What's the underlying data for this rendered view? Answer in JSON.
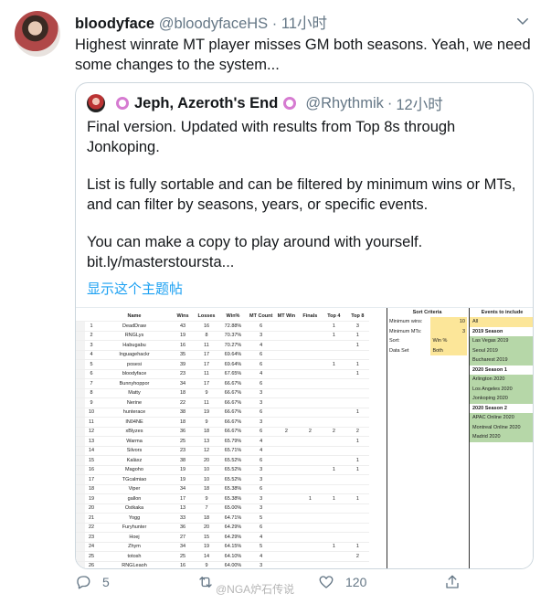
{
  "tweet": {
    "author_name": "bloodyface",
    "author_handle": "@bloodyfaceHS",
    "separator": "·",
    "time": "11小时",
    "text": "Highest winrate MT player misses GM both seasons. Yeah, we need some changes to the system..."
  },
  "quote": {
    "author_name": "Jeph, Azeroth's End",
    "author_handle": "@Rhythmik",
    "separator": "·",
    "time": "12小时",
    "paragraphs": [
      "Final version. Updated with results from Top 8s through Jonkoping.",
      "List is fully sortable and can be filtered by minimum wins or MTs, and can filter by seasons, years, or specific events.",
      "You can make a copy to play around with yourself. bit.ly/masterstoursta..."
    ],
    "translate_label": "显示这个主题帖"
  },
  "sheet": {
    "headers": [
      "Name",
      "Wins",
      "Losses",
      "Win%",
      "MT Count",
      "MT Win",
      "Finals",
      "Top 4",
      "Top 8"
    ],
    "rows": [
      [
        "1",
        "DeadDraw",
        "43",
        "16",
        "72.88%",
        "6",
        "",
        "",
        "1",
        "3"
      ],
      [
        "2",
        "RNGLys",
        "19",
        "8",
        "70.37%",
        "3",
        "",
        "",
        "1",
        "1"
      ],
      [
        "3",
        "Habugabu",
        "16",
        "11",
        "70.27%",
        "4",
        "",
        "",
        "",
        "1"
      ],
      [
        "4",
        "Inguagehackr",
        "35",
        "17",
        "69.64%",
        "6",
        "",
        "",
        "",
        ""
      ],
      [
        "5",
        "posesi",
        "39",
        "17",
        "69.64%",
        "6",
        "",
        "",
        "1",
        "1"
      ],
      [
        "6",
        "bloodyface",
        "23",
        "11",
        "67.65%",
        "4",
        "",
        "",
        "",
        "1"
      ],
      [
        "7",
        "Bunnyhoppor",
        "34",
        "17",
        "66.67%",
        "6",
        "",
        "",
        "",
        ""
      ],
      [
        "8",
        "Matty",
        "18",
        "9",
        "66.67%",
        "3",
        "",
        "",
        "",
        ""
      ],
      [
        "9",
        "Nerine",
        "22",
        "11",
        "66.67%",
        "3",
        "",
        "",
        "",
        ""
      ],
      [
        "10",
        "hunterace",
        "38",
        "19",
        "66.67%",
        "6",
        "",
        "",
        "",
        "1"
      ],
      [
        "11",
        "IN04NE",
        "18",
        "9",
        "66.67%",
        "3",
        "",
        "",
        "",
        ""
      ],
      [
        "12",
        "xBlyzes",
        "36",
        "18",
        "66.67%",
        "6",
        "2",
        "2",
        "2",
        "2"
      ],
      [
        "13",
        "Warma",
        "25",
        "13",
        "65.79%",
        "4",
        "",
        "",
        "",
        "1"
      ],
      [
        "14",
        "Silvors",
        "23",
        "12",
        "65.71%",
        "4",
        "",
        "",
        "",
        ""
      ],
      [
        "15",
        "Kalàxz",
        "38",
        "20",
        "65.52%",
        "6",
        "",
        "",
        "",
        "1"
      ],
      [
        "16",
        "Magoho",
        "19",
        "10",
        "65.52%",
        "3",
        "",
        "",
        "1",
        "1"
      ],
      [
        "17",
        "TGcalmiao",
        "19",
        "10",
        "65.52%",
        "3",
        "",
        "",
        "",
        ""
      ],
      [
        "18",
        "Viper",
        "34",
        "18",
        "65.38%",
        "6",
        "",
        "",
        "",
        ""
      ],
      [
        "19",
        "gallon",
        "17",
        "9",
        "65.38%",
        "3",
        "",
        "1",
        "1",
        "1"
      ],
      [
        "20",
        "Ostkaka",
        "13",
        "7",
        "65.00%",
        "3",
        "",
        "",
        "",
        ""
      ],
      [
        "21",
        "Yogg",
        "33",
        "18",
        "64.71%",
        "5",
        "",
        "",
        "",
        ""
      ],
      [
        "22",
        "Furyhunter",
        "36",
        "20",
        "64.29%",
        "6",
        "",
        "",
        "",
        ""
      ],
      [
        "23",
        "Hoej",
        "27",
        "15",
        "64.29%",
        "4",
        "",
        "",
        "",
        ""
      ],
      [
        "24",
        "Zhym",
        "34",
        "19",
        "64.15%",
        "5",
        "",
        "",
        "1",
        "1"
      ],
      [
        "25",
        "totosh",
        "25",
        "14",
        "64.10%",
        "4",
        "",
        "",
        "",
        "2"
      ],
      [
        "26",
        "RNGLeaoh",
        "16",
        "9",
        "64.00%",
        "3",
        "",
        "",
        "",
        ""
      ],
      [
        "27",
        "Felkeine",
        "29",
        "22",
        "63.93%",
        "6",
        "1",
        "1",
        "2",
        "2"
      ]
    ],
    "criteria": {
      "title": "Sort Criteria",
      "rows": [
        {
          "label": "Minimum wins:",
          "value": "10"
        },
        {
          "label": "Minimum MTs:",
          "value": "3"
        },
        {
          "label": "Sort:",
          "value": "Win %"
        },
        {
          "label": "Data Set",
          "value": "Both"
        }
      ]
    },
    "events": {
      "title": "Events to include",
      "items": [
        {
          "label": "All",
          "style": "first"
        },
        {
          "label": "2019 Season",
          "style": "hdr"
        },
        {
          "label": "Las Vegas 2019",
          "style": "on"
        },
        {
          "label": "Seoul 2019",
          "style": "on"
        },
        {
          "label": "Bucharest 2019",
          "style": "on"
        },
        {
          "label": "2020 Season 1",
          "style": "hdr"
        },
        {
          "label": "Arlington 2020",
          "style": "on"
        },
        {
          "label": "Los Angeles 2020",
          "style": "on"
        },
        {
          "label": "Jonkoping 2020",
          "style": "on"
        },
        {
          "label": "2020 Season 2",
          "style": "hdr"
        },
        {
          "label": "APAC Online 2020",
          "style": "on"
        },
        {
          "label": "Montreal Online 2020",
          "style": "on"
        },
        {
          "label": "Madrid 2020",
          "style": "on"
        }
      ]
    }
  },
  "actions": {
    "reply_count": "5",
    "retweet_count": "",
    "like_count": "120",
    "colors": {
      "icon": "#657786",
      "link": "#1da1f2"
    }
  },
  "watermark": "@NGA炉石传说"
}
